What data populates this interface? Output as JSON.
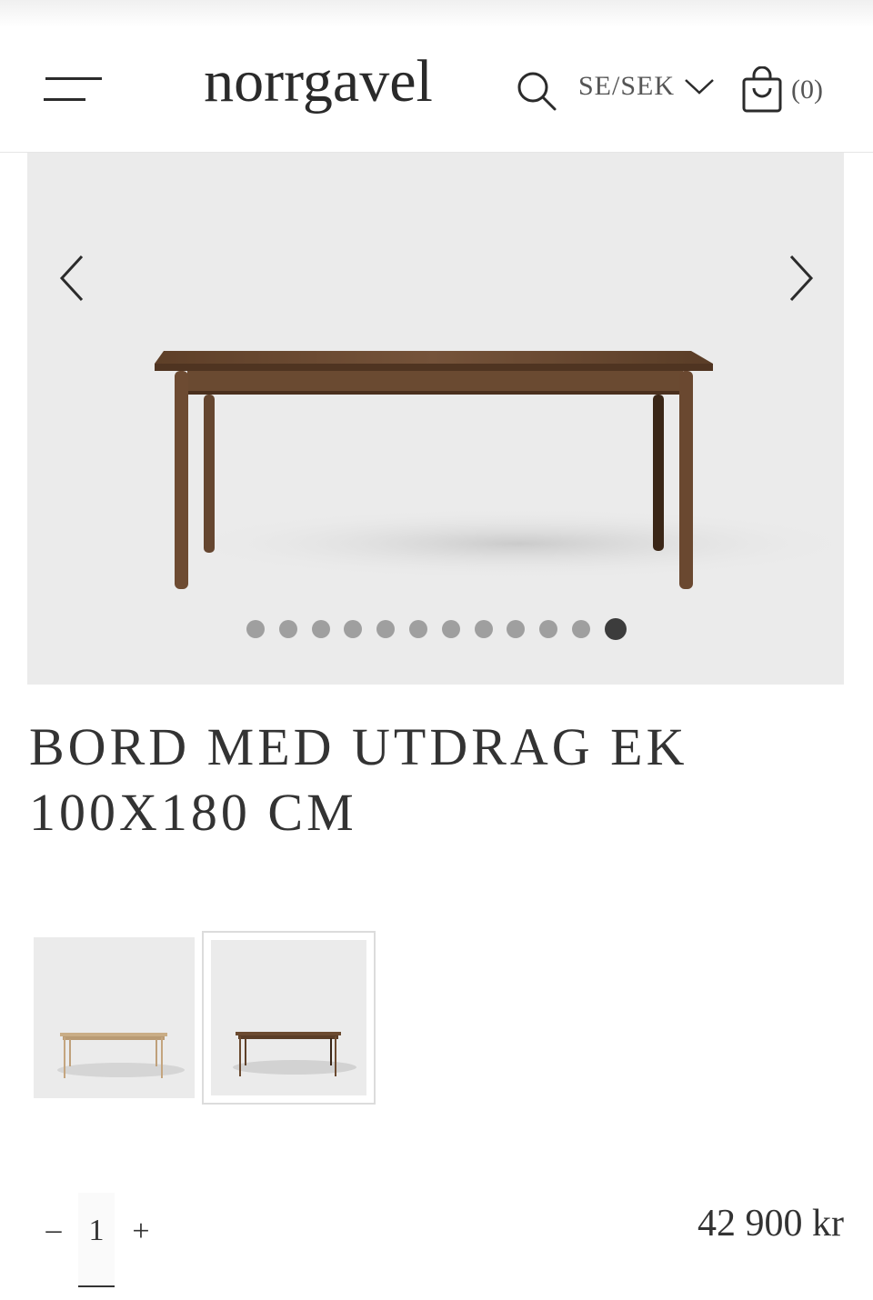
{
  "header": {
    "logo": "norrgavel",
    "locale": "SE/SEK",
    "cart_count": "(0)"
  },
  "gallery": {
    "image": "Extendable oak dining table, dark oiled finish, side view",
    "dot_count": 12,
    "active_dot": 12
  },
  "product": {
    "title_line1": "BORD MED UTDRAG EK",
    "title_line2": "100X180 CM",
    "thumbnails": [
      {
        "finish": "light oak",
        "selected": false
      },
      {
        "finish": "dark oak",
        "selected": true
      }
    ],
    "quantity": "1",
    "minus_label": "–",
    "plus_label": "+",
    "price": "42 900 kr"
  },
  "colors": {
    "text": "#333333",
    "gallery_bg": "#ebebeb",
    "dot": "#9f9f9f",
    "dot_active": "#3c3c3c",
    "wood_dark": "#6b4a30",
    "wood_light": "#c9ad86"
  }
}
